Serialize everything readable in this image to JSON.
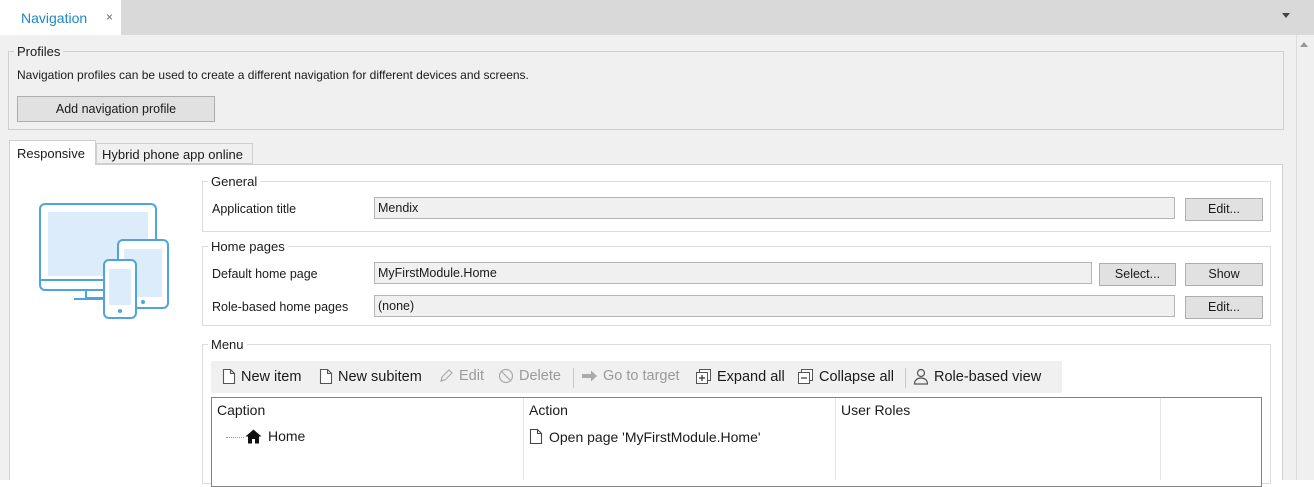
{
  "document_tab": {
    "title": "Navigation",
    "close_glyph": "×"
  },
  "profiles": {
    "legend": "Profiles",
    "description": "Navigation profiles can be used to create a different navigation for different devices and screens.",
    "add_button": "Add navigation profile"
  },
  "profile_tabs": [
    {
      "label": "Responsive",
      "active": true
    },
    {
      "label": "Hybrid phone app online",
      "active": false
    }
  ],
  "device_illustration": {
    "icon": "responsive-devices-icon",
    "color": "#4fa3e0"
  },
  "general": {
    "legend": "General",
    "app_title_label": "Application title",
    "app_title_value": "Mendix",
    "edit_button": "Edit..."
  },
  "home_pages": {
    "legend": "Home pages",
    "default_label": "Default home page",
    "default_value": "MyFirstModule.Home",
    "select_button": "Select...",
    "show_button": "Show",
    "role_label": "Role-based home pages",
    "role_value": "(none)",
    "edit_button": "Edit..."
  },
  "menu": {
    "legend": "Menu",
    "toolbar": {
      "new_item": "New item",
      "new_subitem": "New subitem",
      "edit": "Edit",
      "delete": "Delete",
      "go_to_target": "Go to target",
      "expand_all": "Expand all",
      "collapse_all": "Collapse all",
      "role_based_view": "Role-based view"
    },
    "columns": [
      "Caption",
      "Action",
      "User Roles"
    ],
    "rows": [
      {
        "caption": "Home",
        "action": "Open page 'MyFirstModule.Home'",
        "user_roles": ""
      }
    ]
  },
  "colors": {
    "accent": "#1e88c8",
    "panel": "#f0f0f0",
    "button": "#e1e1e1"
  }
}
